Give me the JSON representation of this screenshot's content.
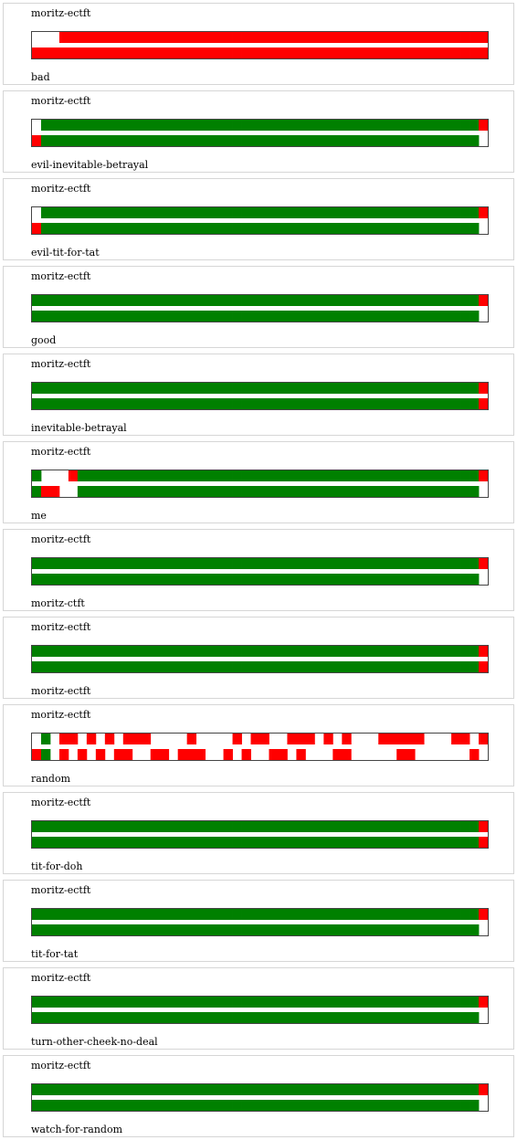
{
  "colors": {
    "cooperate": "#008000",
    "defect": "#ff0000",
    "empty": "#ffffff",
    "border": "#444444",
    "panel_border": "#d6d6d6"
  },
  "legend": {
    "C": "cooperate",
    "D": "defect",
    "_": "empty"
  },
  "matches": [
    {
      "player": "moritz-ectft",
      "opponent": "bad",
      "top_row": "___DDDDDDDDDDDDDDDDDDDDDDDDDDDDDDDDDDDDDDDDDDDDDDDD",
      "bottom_row": "DDDDDDDDDDDDDDDDDDDDDDDDDDDDDDDDDDDDDDDDDDDDDDDDDD"
    },
    {
      "player": "moritz-ectft",
      "opponent": "evil-inevitable-betrayal",
      "top_row": "_CCCCCCCCCCCCCCCCCCCCCCCCCCCCCCCCCCCCCCCCCCCCCCCCD",
      "bottom_row": "DCCCCCCCCCCCCCCCCCCCCCCCCCCCCCCCCCCCCCCCCCCCCCCCC_"
    },
    {
      "player": "moritz-ectft",
      "opponent": "evil-tit-for-tat",
      "top_row": "_CCCCCCCCCCCCCCCCCCCCCCCCCCCCCCCCCCCCCCCCCCCCCCCCD",
      "bottom_row": "DCCCCCCCCCCCCCCCCCCCCCCCCCCCCCCCCCCCCCCCCCCCCCCCC_"
    },
    {
      "player": "moritz-ectft",
      "opponent": "good",
      "top_row": "CCCCCCCCCCCCCCCCCCCCCCCCCCCCCCCCCCCCCCCCCCCCCCCCCD",
      "bottom_row": "CCCCCCCCCCCCCCCCCCCCCCCCCCCCCCCCCCCCCCCCCCCCCCCCC_"
    },
    {
      "player": "moritz-ectft",
      "opponent": "inevitable-betrayal",
      "top_row": "CCCCCCCCCCCCCCCCCCCCCCCCCCCCCCCCCCCCCCCCCCCCCCCCCD",
      "bottom_row": "CCCCCCCCCCCCCCCCCCCCCCCCCCCCCCCCCCCCCCCCCCCCCCCCCD"
    },
    {
      "player": "moritz-ectft",
      "opponent": "me",
      "top_row": "C___DCCCCCCCCCCCCCCCCCCCCCCCCCCCCCCCCCCCCCCCCCCCCD",
      "bottom_row": "CDD__CCCCCCCCCCCCCCCCCCCCCCCCCCCCCCCCCCCCCCCCCCCC_"
    },
    {
      "player": "moritz-ectft",
      "opponent": "moritz-ctft",
      "top_row": "CCCCCCCCCCCCCCCCCCCCCCCCCCCCCCCCCCCCCCCCCCCCCCCCCD",
      "bottom_row": "CCCCCCCCCCCCCCCCCCCCCCCCCCCCCCCCCCCCCCCCCCCCCCCCC_"
    },
    {
      "player": "moritz-ectft",
      "opponent": "moritz-ectft",
      "top_row": "CCCCCCCCCCCCCCCCCCCCCCCCCCCCCCCCCCCCCCCCCCCCCCCCCD",
      "bottom_row": "CCCCCCCCCCCCCCCCCCCCCCCCCCCCCCCCCCCCCCCCCCCCCCCCCD"
    },
    {
      "player": "moritz-ectft",
      "opponent": "random",
      "top_row": "_C_DD_D_D_DDD____D____D_DD__DDD_D_D___DDDDD___DD_D",
      "bottom_row": "DC_D_D_D_DD__DD_DDD__D_D__DD_D___DD_____DD______D_"
    },
    {
      "player": "moritz-ectft",
      "opponent": "tit-for-doh",
      "top_row": "CCCCCCCCCCCCCCCCCCCCCCCCCCCCCCCCCCCCCCCCCCCCCCCCCD",
      "bottom_row": "CCCCCCCCCCCCCCCCCCCCCCCCCCCCCCCCCCCCCCCCCCCCCCCCCD"
    },
    {
      "player": "moritz-ectft",
      "opponent": "tit-for-tat",
      "top_row": "CCCCCCCCCCCCCCCCCCCCCCCCCCCCCCCCCCCCCCCCCCCCCCCCCD",
      "bottom_row": "CCCCCCCCCCCCCCCCCCCCCCCCCCCCCCCCCCCCCCCCCCCCCCCCC_"
    },
    {
      "player": "moritz-ectft",
      "opponent": "turn-other-cheek-no-deal",
      "top_row": "CCCCCCCCCCCCCCCCCCCCCCCCCCCCCCCCCCCCCCCCCCCCCCCCCD",
      "bottom_row": "CCCCCCCCCCCCCCCCCCCCCCCCCCCCCCCCCCCCCCCCCCCCCCCCC_"
    },
    {
      "player": "moritz-ectft",
      "opponent": "watch-for-random",
      "top_row": "CCCCCCCCCCCCCCCCCCCCCCCCCCCCCCCCCCCCCCCCCCCCCCCCCD",
      "bottom_row": "CCCCCCCCCCCCCCCCCCCCCCCCCCCCCCCCCCCCCCCCCCCCCCCCC_"
    }
  ]
}
